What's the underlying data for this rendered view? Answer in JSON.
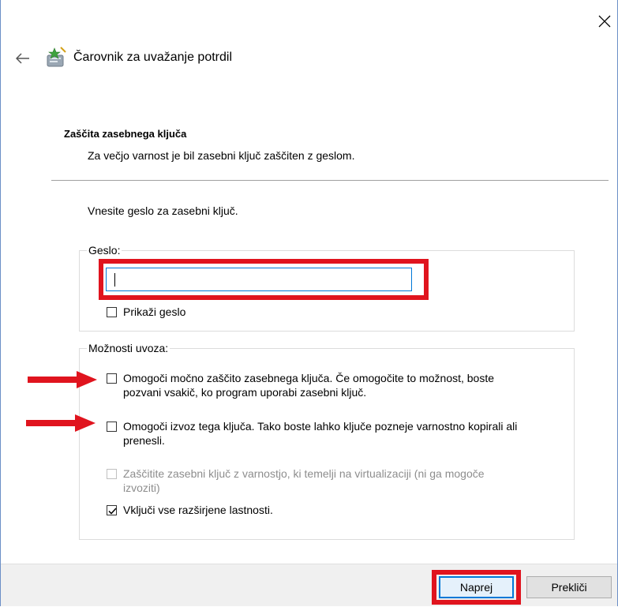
{
  "window": {
    "close_icon": "close-icon"
  },
  "header": {
    "back_icon": "back-arrow-icon",
    "wizard_icon": "certificate-wizard-icon",
    "title": "Čarovnik za uvažanje potrdil"
  },
  "section": {
    "title": "Zaščita zasebnega ključa",
    "description": "Za večjo varnost je bil zasebni ključ zaščiten z geslom."
  },
  "intro": "Vnesite geslo za zasebni ključ.",
  "password_group": {
    "legend": "Geslo:",
    "input_value": "",
    "show_password_label": "Prikaži geslo",
    "show_password_checked": false
  },
  "import_options": {
    "legend": "Možnosti uvoza:",
    "options": [
      {
        "line1": "Omogoči močno zaščito zasebnega ključa. Če omogočite to možnost, boste",
        "line2": "pozvani vsakič, ko program uporabi zasebni ključ.",
        "checked": false,
        "enabled": true
      },
      {
        "line1": "Omogoči izvoz tega ključa. Tako boste lahko ključe pozneje varnostno kopirali ali",
        "line2": "prenesli.",
        "checked": false,
        "enabled": true
      },
      {
        "line1": "Zaščitite zasebni ključ z varnostjo, ki temelji na virtualizaciji (ni ga mogoče",
        "line2": "izvoziti)",
        "checked": false,
        "enabled": false
      },
      {
        "line1": "Vključi vse razširjene lastnosti.",
        "checked": true,
        "enabled": true
      }
    ]
  },
  "footer": {
    "next_label": "Naprej",
    "cancel_label": "Prekliči"
  },
  "colors": {
    "highlight": "#e0141e",
    "accent": "#0078d7"
  }
}
